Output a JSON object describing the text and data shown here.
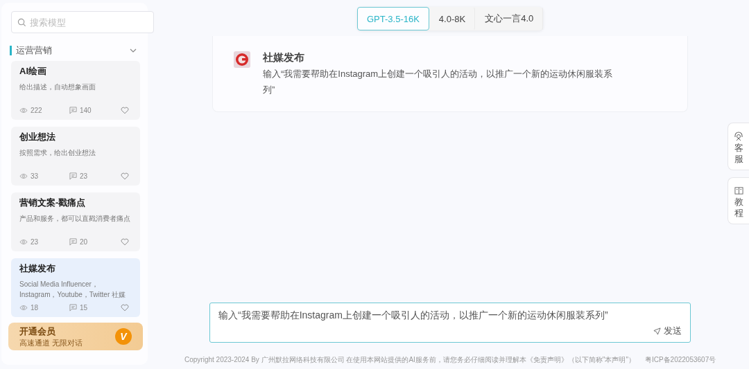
{
  "sidebar": {
    "search": {
      "placeholder": "搜索模型"
    },
    "category": {
      "label": "运营营销",
      "expanded": true
    },
    "cards": [
      {
        "title": "AI绘画",
        "description": "给出描述，自动想象画面",
        "views": "222",
        "comments": "140",
        "selected": false
      },
      {
        "title": "创业想法",
        "description": "按照需求，给出创业想法",
        "views": "33",
        "comments": "23",
        "selected": false
      },
      {
        "title": "营销文案-戳痛点",
        "description": "产品和服务，都可以直戳消费者痛点",
        "views": "23",
        "comments": "20",
        "selected": false
      },
      {
        "title": "社媒发布",
        "description": "Social Media Influencer，Instagram，Youtube，Twitter 社媒",
        "views": "18",
        "comments": "15",
        "selected": true
      }
    ],
    "membership": {
      "title": "开通会员",
      "subtitle": "高速通道 无限对话",
      "badge": "V"
    }
  },
  "model_tabs": [
    {
      "label": "GPT-3.5-16K",
      "selected": true
    },
    {
      "label": "4.0-8K",
      "selected": false
    },
    {
      "label": "文心一言4.0",
      "selected": false
    }
  ],
  "assistant": {
    "name": "社媒发布",
    "prompt": "输入“我需要帮助在Instagram上创建一个吸引人的活动，以推广一个新的运动休闲服装系列”"
  },
  "input": {
    "value": "输入“我需要帮助在Instagram上创建一个吸引人的活动，以推广一个新的运动休闲服装系列”",
    "send": "发送"
  },
  "footer": {
    "copyright": "Copyright 2023-2024 By 广州默拉网络科技有限公司 在使用本网站提供的AI服务前，请您务必仔细阅读并理解本《免责声明》（以下简称\"本声明\"）",
    "icp": "粤ICP备2022053607号"
  },
  "side_tabs": [
    {
      "label": "客服",
      "kind": "support"
    },
    {
      "label": "教程",
      "kind": "book"
    }
  ]
}
